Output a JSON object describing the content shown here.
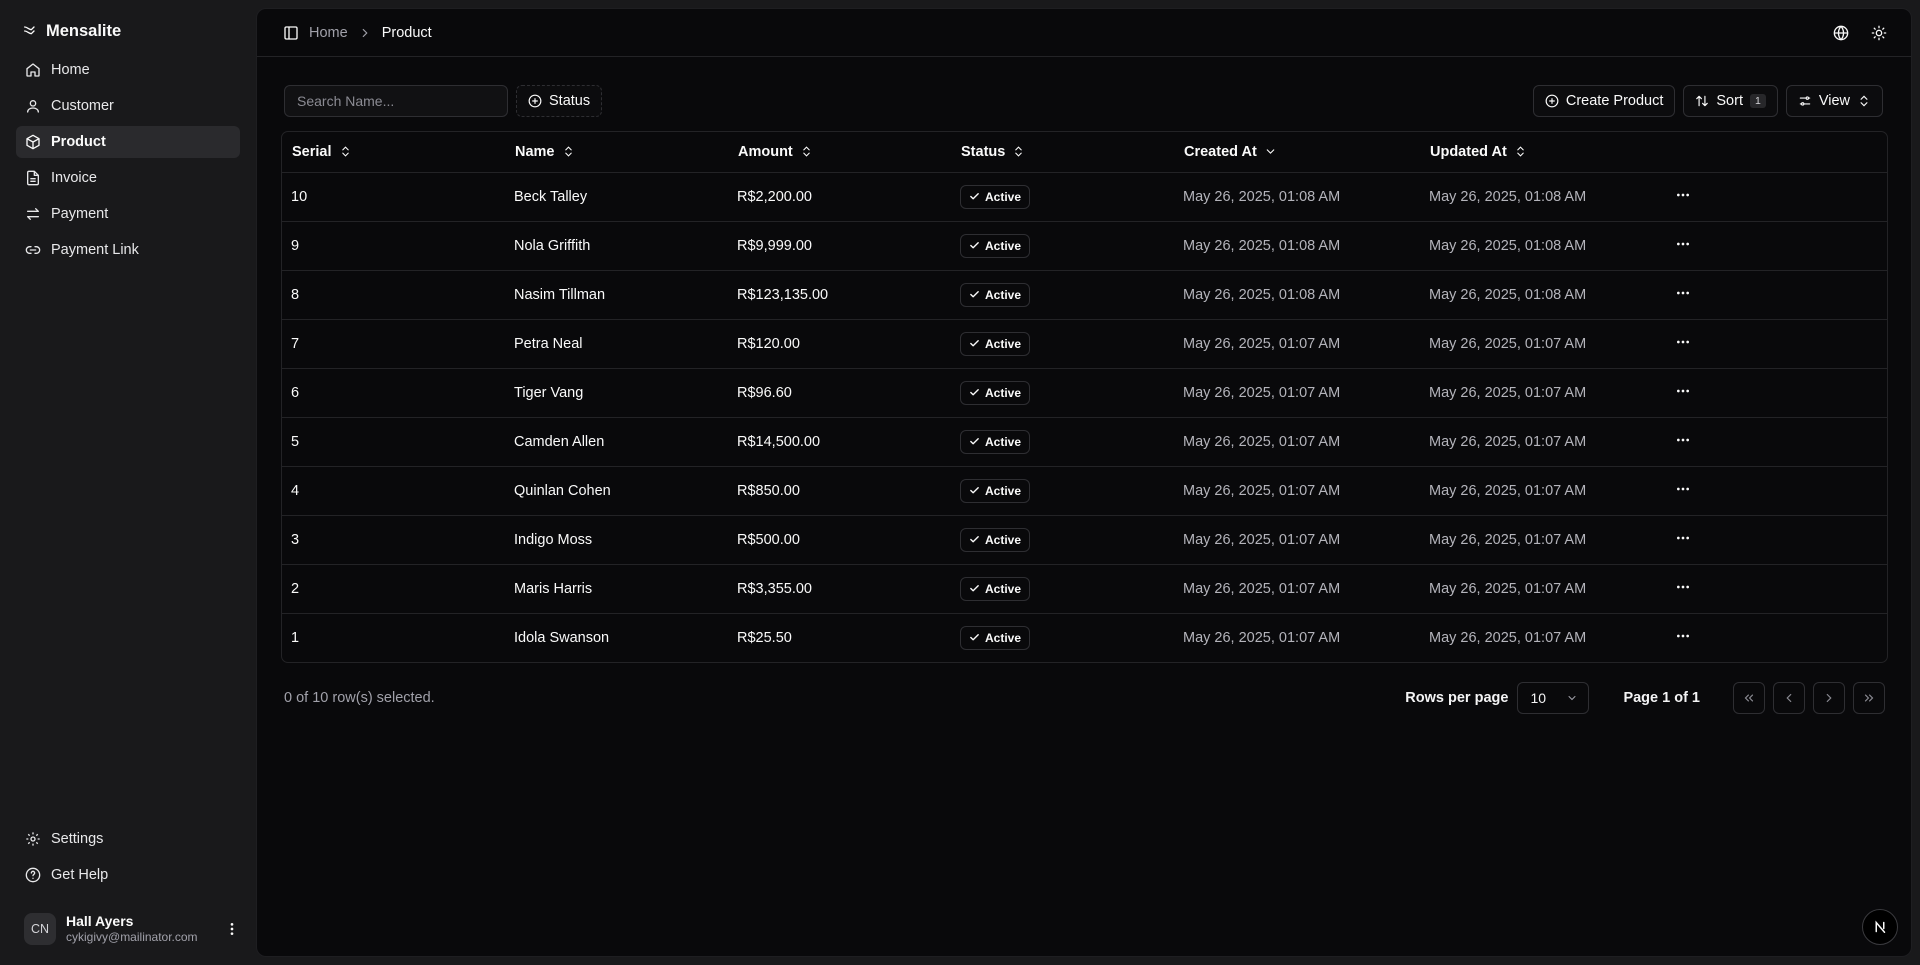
{
  "app": {
    "name": "Mensalite"
  },
  "sidebar": {
    "items": [
      {
        "label": "Home",
        "icon": "house-icon"
      },
      {
        "label": "Customer",
        "icon": "user-icon"
      },
      {
        "label": "Product",
        "icon": "package-icon",
        "active": true
      },
      {
        "label": "Invoice",
        "icon": "file-icon"
      },
      {
        "label": "Payment",
        "icon": "arrows-icon"
      },
      {
        "label": "Payment Link",
        "icon": "link-icon"
      }
    ],
    "bottom": [
      {
        "label": "Settings",
        "icon": "gear-icon"
      },
      {
        "label": "Get Help",
        "icon": "help-circle-icon"
      }
    ],
    "user": {
      "initials": "CN",
      "name": "Hall Ayers",
      "email": "cykigivy@mailinator.com"
    }
  },
  "breadcrumb": {
    "home": "Home",
    "current": "Product"
  },
  "toolbar": {
    "search_placeholder": "Search Name...",
    "status_filter": "Status",
    "create_label": "Create Product",
    "sort_label": "Sort",
    "sort_count": "1",
    "view_label": "View"
  },
  "table": {
    "columns": [
      "Serial",
      "Name",
      "Amount",
      "Status",
      "Created At",
      "Updated At"
    ],
    "rows": [
      {
        "serial": "10",
        "name": "Beck Talley",
        "amount": "R$2,200.00",
        "status": "Active",
        "created": "May 26, 2025, 01:08 AM",
        "updated": "May 26, 2025, 01:08 AM"
      },
      {
        "serial": "9",
        "name": "Nola Griffith",
        "amount": "R$9,999.00",
        "status": "Active",
        "created": "May 26, 2025, 01:08 AM",
        "updated": "May 26, 2025, 01:08 AM"
      },
      {
        "serial": "8",
        "name": "Nasim Tillman",
        "amount": "R$123,135.00",
        "status": "Active",
        "created": "May 26, 2025, 01:08 AM",
        "updated": "May 26, 2025, 01:08 AM"
      },
      {
        "serial": "7",
        "name": "Petra Neal",
        "amount": "R$120.00",
        "status": "Active",
        "created": "May 26, 2025, 01:07 AM",
        "updated": "May 26, 2025, 01:07 AM"
      },
      {
        "serial": "6",
        "name": "Tiger Vang",
        "amount": "R$96.60",
        "status": "Active",
        "created": "May 26, 2025, 01:07 AM",
        "updated": "May 26, 2025, 01:07 AM"
      },
      {
        "serial": "5",
        "name": "Camden Allen",
        "amount": "R$14,500.00",
        "status": "Active",
        "created": "May 26, 2025, 01:07 AM",
        "updated": "May 26, 2025, 01:07 AM"
      },
      {
        "serial": "4",
        "name": "Quinlan Cohen",
        "amount": "R$850.00",
        "status": "Active",
        "created": "May 26, 2025, 01:07 AM",
        "updated": "May 26, 2025, 01:07 AM"
      },
      {
        "serial": "3",
        "name": "Indigo Moss",
        "amount": "R$500.00",
        "status": "Active",
        "created": "May 26, 2025, 01:07 AM",
        "updated": "May 26, 2025, 01:07 AM"
      },
      {
        "serial": "2",
        "name": "Maris Harris",
        "amount": "R$3,355.00",
        "status": "Active",
        "created": "May 26, 2025, 01:07 AM",
        "updated": "May 26, 2025, 01:07 AM"
      },
      {
        "serial": "1",
        "name": "Idola Swanson",
        "amount": "R$25.50",
        "status": "Active",
        "created": "May 26, 2025, 01:07 AM",
        "updated": "May 26, 2025, 01:07 AM"
      }
    ]
  },
  "footer": {
    "selected_text": "0 of 10 row(s) selected.",
    "rows_per_page_label": "Rows per page",
    "rows_per_page_value": "10",
    "page_info": "Page 1 of 1"
  },
  "colors": {
    "background": "#09090b",
    "sidebar": "#19191b",
    "border": "#232326",
    "text": "#fafafa",
    "muted": "#a1a1aa"
  }
}
